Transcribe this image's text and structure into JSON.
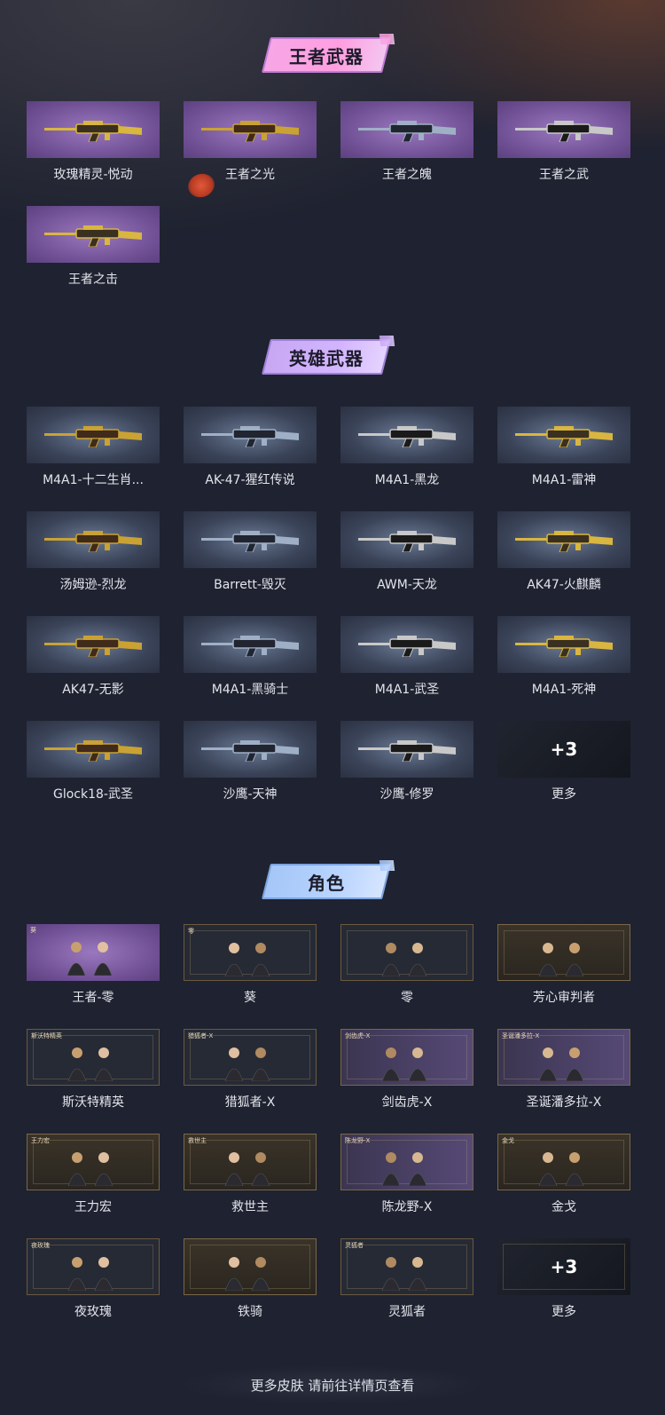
{
  "sections": {
    "royal": {
      "title": "王者武器",
      "items": [
        "玫瑰精灵-悦动",
        "王者之光",
        "王者之魄",
        "王者之武",
        "王者之击"
      ]
    },
    "hero": {
      "title": "英雄武器",
      "items": [
        "M4A1-十二生肖...",
        "AK-47-猩红传说",
        "M4A1-黑龙",
        "M4A1-雷神",
        "汤姆逊-烈龙",
        "Barrett-毁灭",
        "AWM-天龙",
        "AK47-火麒麟",
        "AK47-无影",
        "M4A1-黑骑士",
        "M4A1-武圣",
        "M4A1-死神",
        "Glock18-武圣",
        "沙鹰-天神",
        "沙鹰-修罗",
        "更多"
      ],
      "more_count": "+3"
    },
    "roles": {
      "title": "角色",
      "items": [
        "王者-零",
        "葵",
        "零",
        "芳心审判者",
        "斯沃特精英",
        "猎狐者-X",
        "剑齿虎-X",
        "圣诞潘多拉-X",
        "王力宏",
        "救世主",
        "陈龙野-X",
        "金戈",
        "夜玫瑰",
        "铁骑",
        "灵狐者",
        "更多"
      ],
      "more_count": "+3",
      "thumb_captions": [
        "葵",
        "零",
        "",
        "",
        "斯沃特精英",
        "猎狐者-X",
        "剑齿虎-X",
        "圣诞潘多拉-X",
        "王力宏",
        "救世主",
        "陈龙野-X",
        "金戈",
        "夜玫瑰",
        "",
        "灵狐者",
        ""
      ]
    }
  },
  "footer": {
    "text": "更多皮肤 请前往详情页查看"
  },
  "colors": {
    "background": "#1f2230",
    "royal_banner": "#ff9fe0",
    "hero_banner": "#d3b5ff",
    "role_banner": "#b9d4ff"
  }
}
